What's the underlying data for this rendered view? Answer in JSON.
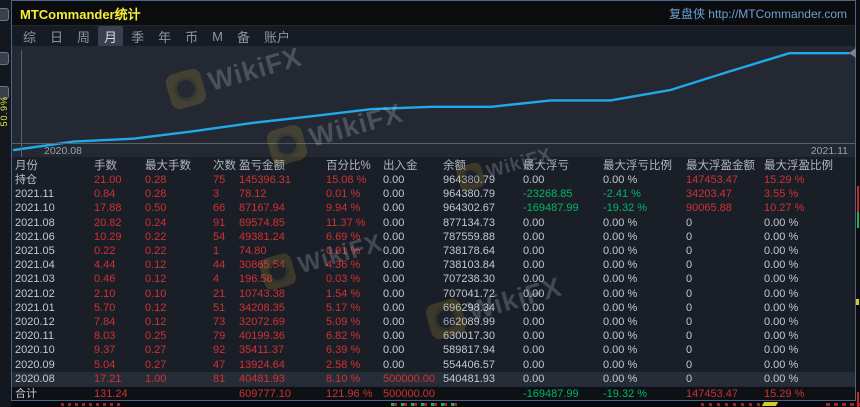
{
  "window": {
    "title": "MTCommander统计",
    "title_right": "复盘侠 http://MTCommander.com"
  },
  "menu": {
    "active_index": 3,
    "items": [
      {
        "key": "zong",
        "label": "综"
      },
      {
        "key": "ri",
        "label": "日"
      },
      {
        "key": "zhou",
        "label": "周"
      },
      {
        "key": "yue",
        "label": "月"
      },
      {
        "key": "ji",
        "label": "季"
      },
      {
        "key": "nian",
        "label": "年"
      },
      {
        "key": "bi",
        "label": "币"
      },
      {
        "key": "m",
        "label": "M"
      },
      {
        "key": "bei",
        "label": "备"
      },
      {
        "key": "zhanghu",
        "label": "账户"
      }
    ]
  },
  "left_strip": {
    "vertical_label": "50.9%"
  },
  "watermark": {
    "text": "WikiFX"
  },
  "chart_data": {
    "type": "line",
    "title": "",
    "xlabel": "",
    "ylabel": "",
    "x_start_label": "2020.08",
    "x_end_label": "2021.11",
    "ylim": [
      500000,
      975000
    ],
    "grid": false,
    "legend": false,
    "series": [
      {
        "name": "余额",
        "color": "#1fa9e8",
        "start_value": 500000.0,
        "x": [
          "2020.08",
          "2020.09",
          "2020.10",
          "2020.11",
          "2020.12",
          "2021.01",
          "2021.02",
          "2021.03",
          "2021.04",
          "2021.05",
          "2021.06",
          "2021.08",
          "2021.10",
          "2021.11"
        ],
        "values": [
          540481.93,
          554406.57,
          589817.94,
          630017.3,
          662089.99,
          696298.34,
          707041.72,
          707238.3,
          738103.84,
          738178.64,
          787559.88,
          877134.73,
          964302.67,
          964380.79
        ]
      }
    ]
  },
  "table": {
    "columns": [
      "月份",
      "手数",
      "最大手数",
      "次数",
      "盈亏金额",
      "百分比%",
      "出入金",
      "余额",
      "最大浮亏",
      "最大浮亏比例",
      "最大浮盈金额",
      "最大浮盈比例"
    ],
    "rows": [
      {
        "name": "row-position",
        "cells": [
          "持仓",
          "21.00",
          "0.28",
          "75",
          "145396.31",
          "15.08 %",
          "0.00",
          "964380.79",
          "0.00",
          "0.00 %",
          "147453.47",
          "15.29 %"
        ]
      },
      {
        "name": "row-2021-11",
        "cells": [
          "2021.11",
          "0.84",
          "0.28",
          "3",
          "78.12",
          "0.01 %",
          "0.00",
          "964380.79",
          "-23268.85",
          "-2.41 %",
          "34203.47",
          "3.55 %"
        ]
      },
      {
        "name": "row-2021-10",
        "cells": [
          "2021.10",
          "17.88",
          "0.50",
          "66",
          "87167.94",
          "9.94 %",
          "0.00",
          "964302.67",
          "-169487.99",
          "-19.32 %",
          "90065.88",
          "10.27 %"
        ]
      },
      {
        "name": "row-2021-08",
        "cells": [
          "2021.08",
          "20.82",
          "0.24",
          "91",
          "89574.85",
          "11.37 %",
          "0.00",
          "877134.73",
          "0.00",
          "0.00 %",
          "0",
          "0.00 %"
        ]
      },
      {
        "name": "row-2021-06",
        "cells": [
          "2021.06",
          "10.29",
          "0.22",
          "54",
          "49381.24",
          "6.69 %",
          "0.00",
          "787559.88",
          "0.00",
          "0.00 %",
          "0",
          "0.00 %"
        ]
      },
      {
        "name": "row-2021-05",
        "cells": [
          "2021.05",
          "0.22",
          "0.22",
          "1",
          "74.80",
          "0.01 %",
          "0.00",
          "738178.64",
          "0.00",
          "0.00 %",
          "0",
          "0.00 %"
        ]
      },
      {
        "name": "row-2021-04",
        "cells": [
          "2021.04",
          "4.44",
          "0.12",
          "44",
          "30865.54",
          "4.36 %",
          "0.00",
          "738103.84",
          "0.00",
          "0.00 %",
          "0",
          "0.00 %"
        ]
      },
      {
        "name": "row-2021-03",
        "cells": [
          "2021.03",
          "0.46",
          "0.12",
          "4",
          "196.58",
          "0.03 %",
          "0.00",
          "707238.30",
          "0.00",
          "0.00 %",
          "0",
          "0.00 %"
        ]
      },
      {
        "name": "row-2021-02",
        "cells": [
          "2021.02",
          "2.10",
          "0.10",
          "21",
          "10743.38",
          "1.54 %",
          "0.00",
          "707041.72",
          "0.00",
          "0.00 %",
          "0",
          "0.00 %"
        ]
      },
      {
        "name": "row-2021-01",
        "cells": [
          "2021.01",
          "5.70",
          "0.12",
          "51",
          "34208.35",
          "5.17 %",
          "0.00",
          "696298.34",
          "0.00",
          "0.00 %",
          "0",
          "0.00 %"
        ]
      },
      {
        "name": "row-2020-12",
        "cells": [
          "2020.12",
          "7.84",
          "0.12",
          "73",
          "32072.69",
          "5.09 %",
          "0.00",
          "662089.99",
          "0.00",
          "0.00 %",
          "0",
          "0.00 %"
        ]
      },
      {
        "name": "row-2020-11",
        "cells": [
          "2020.11",
          "8.03",
          "0.25",
          "79",
          "40199.36",
          "6.82 %",
          "0.00",
          "630017.30",
          "0.00",
          "0.00 %",
          "0",
          "0.00 %"
        ]
      },
      {
        "name": "row-2020-10",
        "cells": [
          "2020.10",
          "9.37",
          "0.27",
          "92",
          "35411.37",
          "6.39 %",
          "0.00",
          "589817.94",
          "0.00",
          "0.00 %",
          "0",
          "0.00 %"
        ]
      },
      {
        "name": "row-2020-09",
        "cells": [
          "2020.09",
          "5.04",
          "0.27",
          "47",
          "13924.64",
          "2.58 %",
          "0.00",
          "554406.57",
          "0.00",
          "0.00 %",
          "0",
          "0.00 %"
        ]
      },
      {
        "name": "row-2020-08",
        "selected": true,
        "cells": [
          "2020.08",
          "17.21",
          "1.00",
          "81",
          "40481.93",
          "8.10 %",
          "500000.00",
          "540481.93",
          "0.00",
          "0.00 %",
          "0",
          "0.00 %"
        ]
      },
      {
        "name": "row-total",
        "total": true,
        "cells": [
          "合计",
          "131.24",
          "",
          "",
          "609777.10",
          "121.96 %",
          "500000.00",
          "",
          "-169487.99",
          "-19.32 %",
          "147453.47",
          "15.29 %"
        ]
      }
    ]
  },
  "colors": {
    "positive_red": "#d03232",
    "negative_green": "#00b76a",
    "neutral_text": "#c3c8d2",
    "header_text": "#b0b6c2",
    "title_yellow": "#f7ee38",
    "link_blue": "#6f9fd4",
    "accent_line": "#1fa9e8",
    "window_bg": "#1b202a",
    "titlebar_bg": "#0b0c0e",
    "menu_text": "#8d95a3",
    "menu_active_bg": "#3a414e",
    "menu_active_text": "#d6dae2",
    "selected_row_bg": "#272d38",
    "total_row_bg": "#0d1014",
    "border_blue": "#4a6686",
    "watermark_gold": "#b59b3a"
  }
}
